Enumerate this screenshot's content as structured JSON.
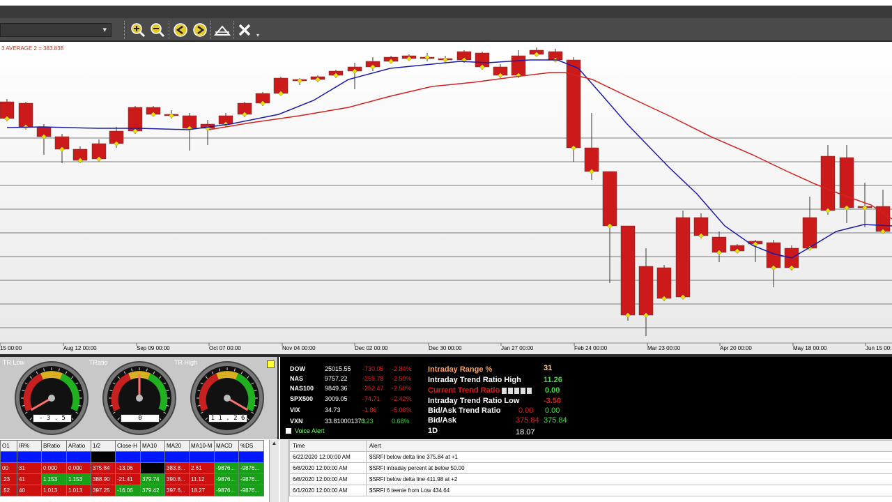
{
  "toolbar": {
    "symbol_value": "",
    "tools": [
      "zoom-in-icon",
      "zoom-out-icon",
      "arrow-left-icon",
      "arrow-right-icon",
      "chart-style-icon",
      "close-icon"
    ]
  },
  "chart": {
    "ma_label": "3 AVERAGE 2 = 383.838",
    "x_labels": [
      "15 00:00",
      "Aug 12 00:00",
      "Sep 09 00:00",
      "Oct 07 00:00",
      "Nov 04 00:00",
      "Dec 02 00:00",
      "Dec 30 00:00",
      "Jan 27 00:00",
      "Feb 24 00:00",
      "Mar 23 00:00",
      "Apr 20 00:00",
      "May 18 00:00",
      "Jun 15 00:"
    ],
    "colors": {
      "up": "#22c22e",
      "down": "#cc1a1a",
      "ma_blue": "#1a1aa8",
      "ma_red": "#d42020",
      "marker": "#f0e000"
    }
  },
  "gauges": [
    {
      "title": "TR Low",
      "reading": "- 3 . 5",
      "value": -3.5
    },
    {
      "title": "TRatio",
      "reading": "0",
      "value": 0
    },
    {
      "title": "TR High",
      "reading": "1 1 . 2 6",
      "value": 11.26
    }
  ],
  "ticker": [
    {
      "symbol": "DOW",
      "value": "25015.55",
      "change": "-730.05",
      "pct": "-2.84%"
    },
    {
      "symbol": "NAS",
      "value": "9757.22",
      "change": "-259.78",
      "pct": "-2.59%"
    },
    {
      "symbol": "NAS100",
      "value": "9849.36",
      "change": "-252.47",
      "pct": "-2.50%"
    },
    {
      "symbol": "SPX500",
      "value": "3009.05",
      "change": "-74.71",
      "pct": "-2.42%"
    },
    {
      "symbol": "VIX",
      "value": "34.73",
      "change": "-1.86",
      "pct": "-5.08%"
    },
    {
      "symbol": "VXN",
      "value": "33.810001373",
      "change": "0.23",
      "pct": "0.68%"
    }
  ],
  "metrics": {
    "range_label": "Intraday Range %",
    "range_value": "31",
    "high_label": "Intraday Trend Ratio High",
    "high_value": "11.26",
    "current_label": "Current Trend Ratio",
    "current_value": "0.00",
    "low_label": "Intraday Trend Ratio Low",
    "low_value": "-3.50",
    "bidask_trend_label": "Bid/Ask Trend Ratio",
    "bidask_trend_v1": "0.00",
    "bidask_trend_v2": "0.00",
    "bidask_label": "Bid/Ask",
    "bidask_v1": "375.84",
    "bidask_v2": "375.84",
    "period_label": "1D",
    "period_value": "18.07",
    "voice_label": "Voice Alert"
  },
  "grid": {
    "headers": [
      "O1",
      "IR%",
      "BRatio",
      "ARatio",
      "1/2",
      "Close-H",
      "MA10",
      "MA20",
      "MA10-M",
      "MACD",
      "%DS"
    ],
    "rows": [
      [
        "",
        "",
        "",
        "",
        "",
        "",
        "",
        "",
        "",
        "",
        ""
      ],
      [
        "00",
        "31",
        "0.000",
        "0.000",
        "375.84",
        "-13.06",
        "",
        "383.8...",
        "2.61",
        "-9876...",
        "-9876..."
      ],
      [
        ".23",
        "41",
        "1.153",
        "1.153",
        "388.90",
        "-21.41",
        "379.74",
        "390.8...",
        "11.12",
        "-9876...",
        "-9876..."
      ],
      [
        ".52",
        "40",
        "1.013",
        "1.013",
        "397.25",
        "-16.06",
        "379.42",
        "397.6...",
        "18.27",
        "-9876...",
        "-9876..."
      ]
    ]
  },
  "alerts": {
    "headers": [
      "Time",
      "Alert"
    ],
    "rows": [
      [
        "6/22/2020 12:00:00 AM",
        "$SRFI below delta line 375.84 at +1"
      ],
      [
        "6/8/2020 12:00:00 AM",
        "$SRFI intraday percent at below 50.00"
      ],
      [
        "6/8/2020 12:00:00 AM",
        "$SRFI below delta line 411.98 at +2"
      ],
      [
        "6/1/2020 12:00:00 AM",
        "$SRFI 6 teenie from Low 434.64"
      ]
    ]
  }
}
